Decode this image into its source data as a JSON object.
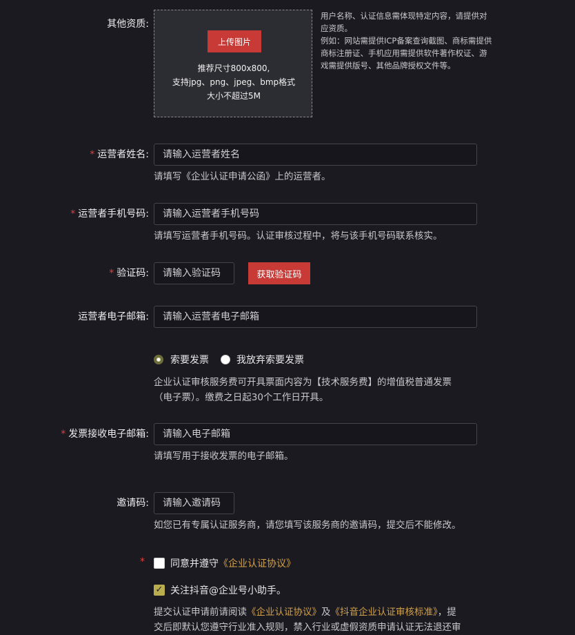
{
  "other_qualification": {
    "label": "其他资质:",
    "upload_button": "上传图片",
    "hint_line1": "推荐尺寸800x800,",
    "hint_line2": "支持jpg、png、jpeg、bmp格式",
    "hint_line3": "大小不超过5M",
    "side_note": "用户名称、认证信息需体现特定内容，请提供对应资质。\n例如：网站需提供ICP备案查询截图、商标需提供商标注册证、手机应用需提供软件著作权证、游戏需提供版号、其他品牌授权文件等。"
  },
  "operator_name": {
    "required": "*",
    "label": "运营者姓名:",
    "placeholder": "请输入运营者姓名",
    "help": "请填写《企业认证申请公函》上的运营者。"
  },
  "operator_phone": {
    "required": "*",
    "label": "运营者手机号码:",
    "placeholder": "请输入运营者手机号码",
    "help": "请填写运营者手机号码。认证审核过程中，将与该手机号码联系核实。"
  },
  "verify_code": {
    "required": "*",
    "label": "验证码:",
    "placeholder": "请输入验证码",
    "button": "获取验证码"
  },
  "operator_email": {
    "label": "运营者电子邮箱:",
    "placeholder": "请输入运营者电子邮箱"
  },
  "invoice_choice": {
    "option1": "索要发票",
    "option2": "我放弃索要发票",
    "selected": "索要发票",
    "help_line1": "企业认证审核服务费可开具票面内容为【技术服务费】的增值税普通发票",
    "help_line2": "（电子票）。缴费之日起30个工作日开具。"
  },
  "invoice_email": {
    "required": "*",
    "label": "发票接收电子邮箱:",
    "placeholder": "请输入电子邮箱",
    "help": "请填写用于接收发票的电子邮箱。"
  },
  "invite_code": {
    "label": "邀请码:",
    "placeholder": "请输入邀请码",
    "help": "如您已有专属认证服务商，请您填写该服务商的邀请码，提交后不能修改。"
  },
  "agreement": {
    "required": "*",
    "text": "同意并遵守",
    "link": "《企业认证协议》",
    "checked": false
  },
  "follow": {
    "text": "关注抖音@企业号小助手。",
    "checked": true
  },
  "notice": {
    "prefix": "提交认证申请前请阅读",
    "link1": "《企业认证协议》",
    "mid": "及",
    "link2": "《抖音企业认证审核标准》",
    "suffix": "，提",
    "line2": "交后即默认您遵守行业准入规则，禁入行业或虚假资质申请认证无法退还审"
  }
}
